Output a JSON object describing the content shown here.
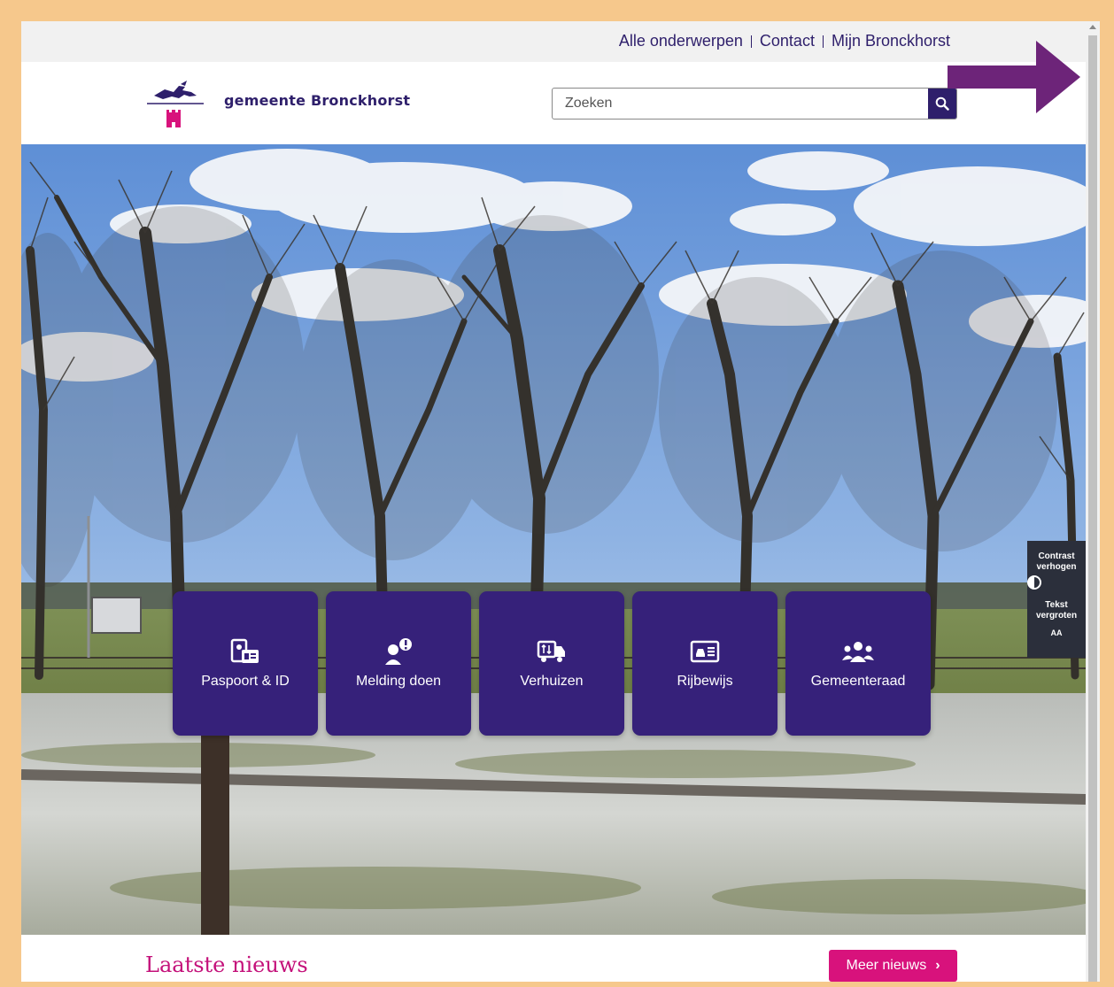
{
  "top_nav": {
    "items": [
      "Alle onderwerpen",
      "Contact",
      "Mijn Bronckhorst"
    ]
  },
  "header": {
    "brand": "gemeente Bronckhorst",
    "search_placeholder": "Zoeken",
    "search_icon": "search-icon"
  },
  "tiles": [
    {
      "label": "Paspoort & ID",
      "icon": "passport-icon"
    },
    {
      "label": "Melding doen",
      "icon": "report-icon"
    },
    {
      "label": "Verhuizen",
      "icon": "moving-truck-icon"
    },
    {
      "label": "Rijbewijs",
      "icon": "driving-license-icon"
    },
    {
      "label": "Gemeenteraad",
      "icon": "council-icon"
    }
  ],
  "accessibility": {
    "contrast_label": "Contrast verhogen",
    "text_label": "Tekst vergroten",
    "text_icon_text": "AA"
  },
  "news": {
    "title": "Laatste nieuws",
    "more_label": "Meer nieuws"
  },
  "colors": {
    "brand_purple": "#2e1f6b",
    "tile_purple": "#36217a",
    "accent_pink": "#d8127c",
    "frame": "#f6c88c",
    "annotation_arrow": "#6d2479"
  }
}
